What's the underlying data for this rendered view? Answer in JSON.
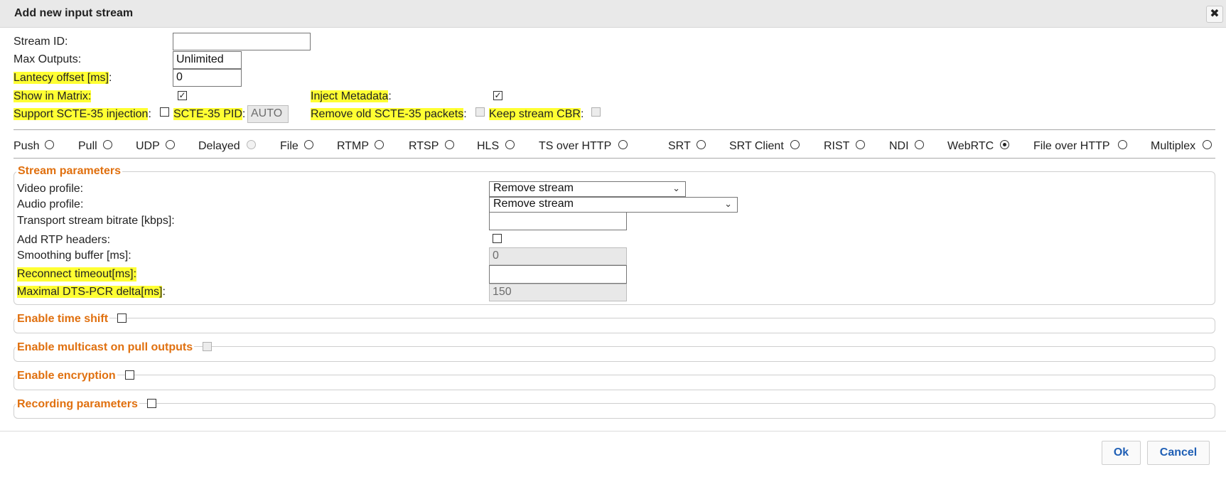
{
  "dialog": {
    "title": "Add new input stream",
    "close_symbol": "✖"
  },
  "general": {
    "stream_id_label": "Stream ID:",
    "stream_id_value": "",
    "max_outputs_label": "Max Outputs:",
    "max_outputs_value": "Unlimited",
    "latency_label": "Lantecy offset [ms]",
    "latency_colon": ":",
    "latency_value": "0",
    "show_matrix_label": "Show in Matrix",
    "show_matrix_colon": ":",
    "show_matrix_checked": true,
    "inject_metadata_label": "Inject Metadata",
    "inject_metadata_colon": ":",
    "inject_metadata_checked": true,
    "scte_support_label": "Support SCTE-35 injection",
    "scte_support_colon": ":",
    "scte_pid_label": "SCTE-35 PID",
    "scte_pid_colon": ":",
    "scte_pid_value": "AUTO",
    "remove_old_label": "Remove old SCTE-35 packets",
    "remove_old_colon": ":",
    "keep_cbr_label": "Keep stream CBR",
    "keep_cbr_colon": ":"
  },
  "protocols": {
    "selected": "WebRTC",
    "items": [
      "Push",
      "Pull",
      "UDP",
      "Delayed",
      "File",
      "RTMP",
      "RTSP",
      "HLS",
      "TS over HTTP",
      "SRT",
      "SRT Client",
      "RIST",
      "NDI",
      "WebRTC",
      "File over HTTP",
      "Multiplex"
    ]
  },
  "stream_params": {
    "legend": "Stream parameters",
    "video_profile_label": "Video profile:",
    "video_profile_value": "Remove stream",
    "audio_profile_label": "Audio profile:",
    "audio_profile_value": "Remove stream",
    "ts_bitrate_label": "Transport stream bitrate [kbps]:",
    "ts_bitrate_value": "",
    "rtp_headers_label": "Add RTP headers:",
    "smoothing_label": "Smoothing buffer [ms]:",
    "smoothing_value": "0",
    "reconnect_label": "Reconnect timeout[ms]:",
    "reconnect_value": "",
    "dts_label": "Maximal DTS-PCR delta[ms]",
    "dts_colon": ":",
    "dts_value": "150"
  },
  "sections": {
    "time_shift": "Enable time shift",
    "multicast": "Enable multicast on pull outputs",
    "encryption": "Enable encryption",
    "recording": "Recording parameters"
  },
  "footer": {
    "ok_label": "Ok",
    "cancel_label": "Cancel"
  },
  "colors": {
    "highlight": "#ffff33",
    "legend": "#e0700f",
    "button_text": "#1f5fb5"
  }
}
